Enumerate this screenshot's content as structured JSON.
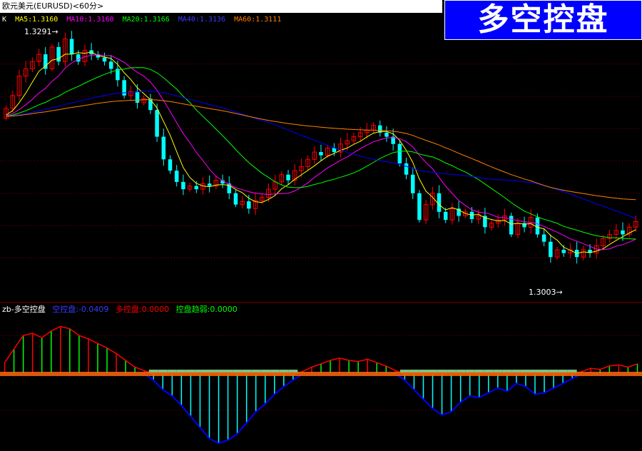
{
  "header": {
    "symbol_title": "欧元美元(EURUSD)<60分>",
    "badge_text": "多空控盘"
  },
  "ma_legend": {
    "k_label": "K",
    "items": [
      {
        "text": "MA5:1.3160",
        "color": "#ffffff"
      },
      {
        "text": "MA10:1.3160",
        "color": "#ff00ff"
      },
      {
        "text": "MA20:1.3166",
        "color": "#00ff00"
      },
      {
        "text": "MA40:1.3136",
        "color": "#0000ff"
      },
      {
        "text": "MA60:1.3111",
        "color": "#ff8000"
      }
    ]
  },
  "indicator_legend": {
    "items": [
      {
        "text": "zb-多空控盘",
        "color": "#ffffff"
      },
      {
        "text": "空控盘:-0.0409",
        "color": "#0000ff"
      },
      {
        "text": "多控盘:0.0000",
        "color": "#ff0000"
      },
      {
        "text": "控盘趋弱:0.0000",
        "color": "#00ff00"
      }
    ]
  },
  "annotations": {
    "high_label": "1.3291",
    "low_label": "1.3003"
  },
  "colors": {
    "up_candle": "#ff0000",
    "down_candle": "#00ffff",
    "ma5": "#ffff00",
    "ma10": "#ff00ff",
    "ma20": "#00ff00",
    "ma40": "#0000ff",
    "ma60": "#ff8000",
    "grid": "#800000"
  },
  "chart_data": [
    {
      "type": "candlestick",
      "title": "欧元美元(EURUSD)<60分>",
      "ylim": [
        1.297,
        1.3318
      ],
      "grid": true,
      "series": [
        {
          "name": "K",
          "note": "hourly candles"
        },
        {
          "name": "MA5",
          "value": 1.316
        },
        {
          "name": "MA10",
          "value": 1.316
        },
        {
          "name": "MA20",
          "value": 1.3166
        },
        {
          "name": "MA40",
          "value": 1.3136
        },
        {
          "name": "MA60",
          "value": 1.3111
        }
      ],
      "annotations": [
        {
          "text": "1.3291",
          "value": 1.3291
        },
        {
          "text": "1.3003",
          "value": 1.3003
        }
      ],
      "closes": [
        1.3205,
        1.3221,
        1.3245,
        1.3254,
        1.3263,
        1.3272,
        1.3254,
        1.3281,
        1.3263,
        1.3291,
        1.3272,
        1.3263,
        1.3277,
        1.3272,
        1.3268,
        1.3263,
        1.3254,
        1.324,
        1.3221,
        1.3226,
        1.3212,
        1.3217,
        1.3203,
        1.317,
        1.3142,
        1.3128,
        1.3114,
        1.3105,
        1.3109,
        1.3105,
        1.3112,
        1.3109,
        1.3116,
        1.3112,
        1.31,
        1.3086,
        1.309,
        1.3081,
        1.3091,
        1.3095,
        1.3105,
        1.3114,
        1.3123,
        1.3116,
        1.3128,
        1.3133,
        1.3142,
        1.3151,
        1.3147,
        1.3156,
        1.3151,
        1.3161,
        1.3165,
        1.317,
        1.3175,
        1.3178,
        1.3184,
        1.3175,
        1.317,
        1.3161,
        1.3137,
        1.3123,
        1.31,
        1.3067,
        1.3086,
        1.31,
        1.3077,
        1.3067,
        1.3081,
        1.3072,
        1.3077,
        1.3068,
        1.3072,
        1.3058,
        1.3063,
        1.3067,
        1.3072,
        1.3049,
        1.3063,
        1.3058,
        1.307,
        1.3049,
        1.304,
        1.3021,
        1.303,
        1.3026,
        1.303,
        1.3021,
        1.303,
        1.3026,
        1.3035,
        1.3044,
        1.3049,
        1.3054,
        1.3049,
        1.3058,
        1.3065
      ]
    },
    {
      "type": "bar",
      "title": "zb-多空控盘",
      "series": [
        {
          "name": "空控盘",
          "value": -0.0409
        },
        {
          "name": "多控盘",
          "value": 0.0
        },
        {
          "name": "控盘趋弱",
          "value": 0.0
        }
      ],
      "values": [
        0.01,
        0.022,
        0.034,
        0.036,
        0.032,
        0.038,
        0.042,
        0.04,
        0.034,
        0.031,
        0.027,
        0.023,
        0.018,
        0.012,
        0.006,
        0.003,
        -0.004,
        -0.01,
        -0.014,
        -0.02,
        -0.027,
        -0.034,
        -0.041,
        -0.044,
        -0.042,
        -0.038,
        -0.031,
        -0.024,
        -0.019,
        -0.013,
        -0.008,
        -0.004,
        0.002,
        0.006,
        0.009,
        0.012,
        0.014,
        0.012,
        0.011,
        0.013,
        0.01,
        0.007,
        0.003,
        -0.004,
        -0.01,
        -0.016,
        -0.022,
        -0.026,
        -0.024,
        -0.018,
        -0.014,
        -0.015,
        -0.012,
        -0.009,
        -0.011,
        -0.006,
        -0.008,
        -0.013,
        -0.012,
        -0.009,
        -0.006,
        -0.003,
        0.002,
        0.005,
        0.004,
        0.007,
        0.008,
        0.006,
        0.009
      ],
      "ylim": [
        -0.048,
        0.048
      ]
    }
  ]
}
